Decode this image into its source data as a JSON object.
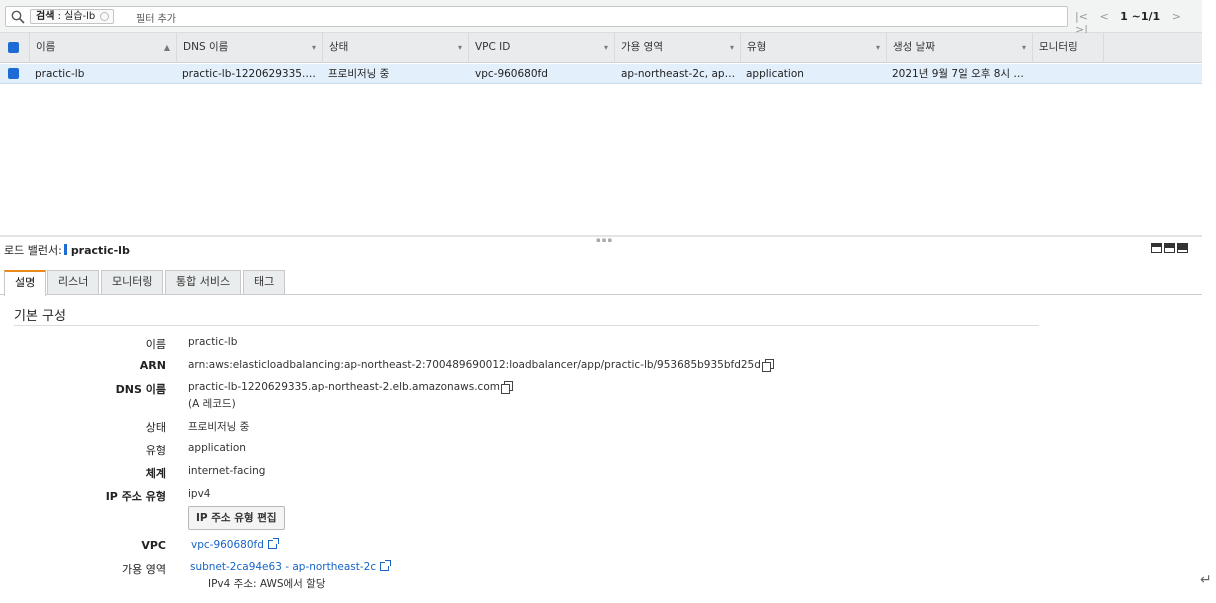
{
  "search": {
    "chip_key": "검색",
    "chip_value": " : 실습-lb",
    "placeholder": "필터 추가"
  },
  "pager": {
    "first": "|<",
    "prev": "<",
    "range": "1 ~1/1",
    "next": ">",
    "last": ">|"
  },
  "table": {
    "headers": [
      "이름",
      "DNS 이름",
      "상태",
      "VPC ID",
      "가용 영역",
      "유형",
      "생성 날짜",
      "모니터링"
    ],
    "row": {
      "name": "practic-lb",
      "dns": "practic-lb-1220629335.ap-no...",
      "status": "프로비저닝 중",
      "vpc": "vpc-960680fd",
      "az": "ap-northeast-2c, ap-nor...",
      "type": "application",
      "created": "2021년 9월 7일 오후 8시 54...",
      "monitoring": ""
    }
  },
  "detail": {
    "title_label": "로드 밸런서:",
    "title_name": "practic-lb",
    "tabs": [
      "설명",
      "리스너",
      "모니터링",
      "통합 서비스",
      "태그"
    ],
    "section": "기본 구성",
    "fields": {
      "name_label": "이름",
      "name": "practic-lb",
      "arn_label": "ARN",
      "arn": "arn:aws:elasticloadbalancing:ap-northeast-2:700489690012:loadbalancer/app/practic-lb/953685b935bfd25d",
      "dns_label": "DNS 이름",
      "dns": "practic-lb-1220629335.ap-northeast-2.elb.amazonaws.com",
      "dns_note": "(A 레코드)",
      "status_label": "상태",
      "status": "프로비저닝 중",
      "type_label": "유형",
      "type": "application",
      "scheme_label": "체계",
      "scheme": "internet-facing",
      "ip_label": "IP 주소 유형",
      "ip": "ipv4",
      "ip_edit_button": "IP 주소 유형 편집",
      "vpc_label": "VPC",
      "vpc": "vpc-960680fd",
      "az_label": "가용 영역",
      "az": "subnet-2ca94e63 - ap-northeast-2c",
      "az_note": "IPv4 주소: AWS에서 할당"
    }
  },
  "colors": {
    "accent": "#1f6bd6",
    "link": "#1664c6",
    "tab_active": "#e88b1a"
  }
}
